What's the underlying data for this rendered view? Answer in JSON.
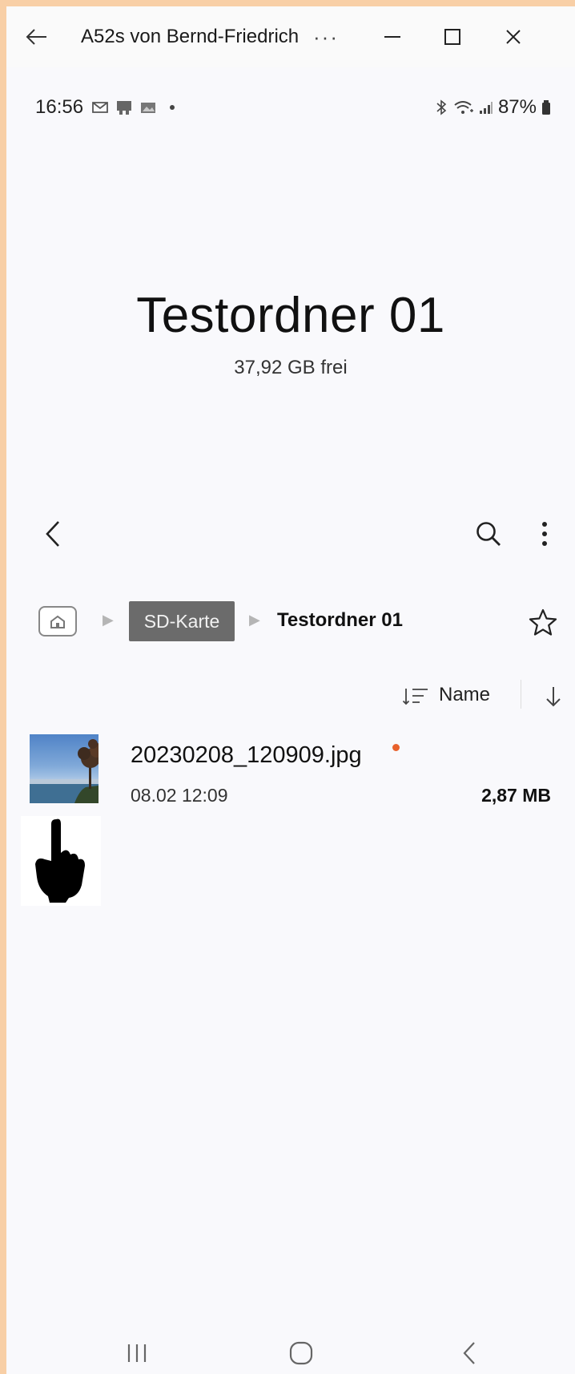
{
  "window": {
    "title": "A52s von Bernd-Friedrich",
    "more_label": "···"
  },
  "status_bar": {
    "time": "16:56",
    "battery": "87%"
  },
  "header": {
    "folder_title": "Testordner 01",
    "free_space": "37,92 GB frei"
  },
  "breadcrumb": {
    "items": [
      "SD-Karte",
      "Testordner 01"
    ]
  },
  "sort": {
    "label": "Name"
  },
  "files": [
    {
      "name": "20230208_120909.jpg",
      "date": "08.02 12:09",
      "size": "2,87 MB"
    }
  ],
  "colors": {
    "background": "#f9f9fc",
    "frame_border": "#f8cfa6",
    "new_indicator": "#e8612c",
    "breadcrumb_chip": "#6b6b6b"
  }
}
